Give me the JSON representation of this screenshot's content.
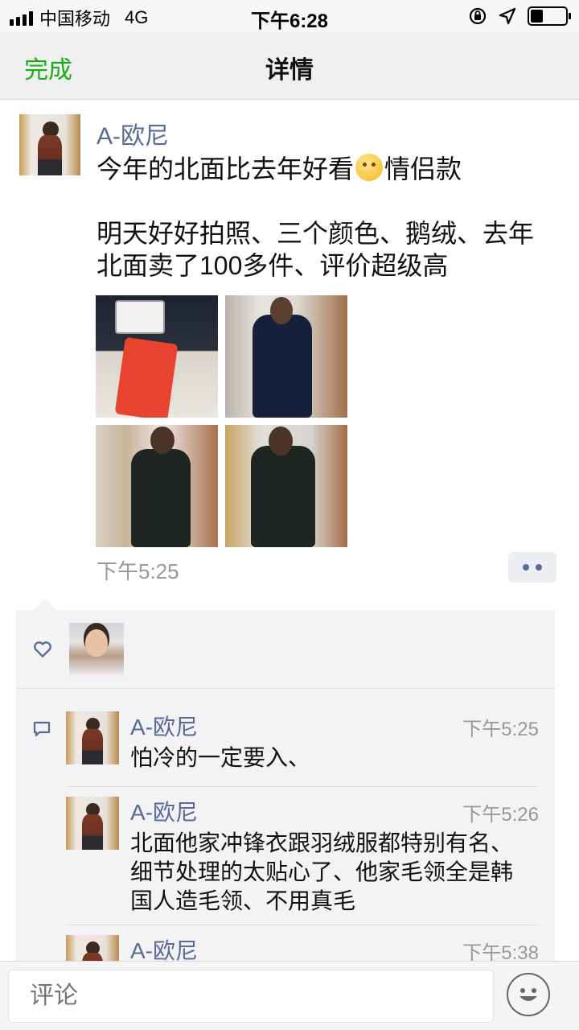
{
  "status_bar": {
    "carrier": "中国移动",
    "network": "4G",
    "time": "下午6:28",
    "battery_level": 0.35
  },
  "nav": {
    "done_label": "完成",
    "title": "详情"
  },
  "post": {
    "author": "A-欧尼",
    "text_line1_before": "今年的北面比去年好看",
    "text_line1_emoji": "thinking-face-emoji",
    "text_line1_after": "情侣款",
    "text_body": "明天好好拍照、三个颜色、鹅绒、去年北面卖了100多件、评价超级高",
    "photos": [
      "the-north-face-tag-photo",
      "mirror-selfie-navy-parka",
      "mirror-selfie-olive-parka-side",
      "mirror-selfie-olive-parka-back"
    ],
    "time": "下午5:25"
  },
  "comments": [
    {
      "author": "A-欧尼",
      "time": "下午5:25",
      "text": "怕冷的一定要入、"
    },
    {
      "author": "A-欧尼",
      "time": "下午5:26",
      "text": "北面他家冲锋衣跟羽绒服都特别有名、细节处理的太贴心了、他家毛领全是韩国人造毛领、不用真毛"
    },
    {
      "author": "A-欧尼",
      "time": "下午5:38",
      "text": ""
    }
  ],
  "input": {
    "placeholder": "评论"
  },
  "colors": {
    "accent_green": "#1aad19",
    "author_blue": "#576b95"
  }
}
